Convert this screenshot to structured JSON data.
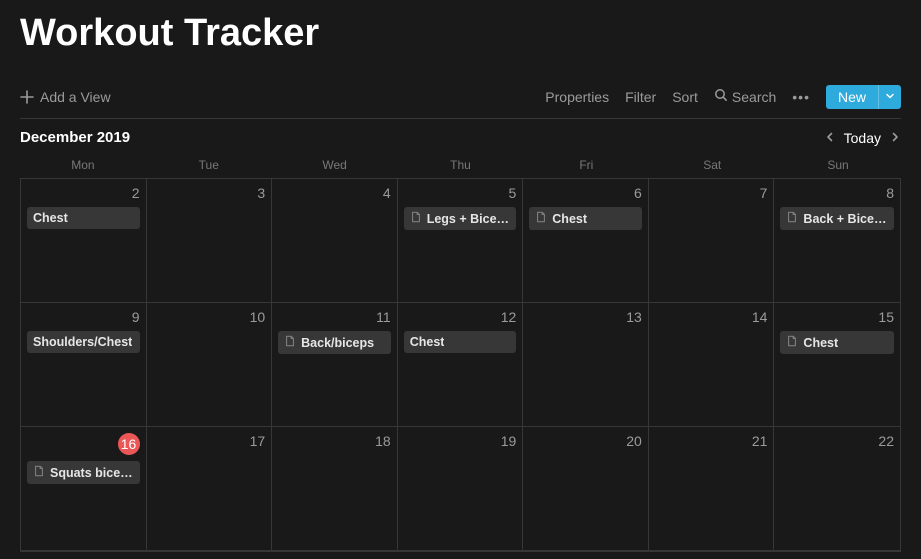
{
  "title": "Workout Tracker",
  "toolbar": {
    "add_view": "Add a View",
    "properties": "Properties",
    "filter": "Filter",
    "sort": "Sort",
    "search": "Search",
    "new": "New"
  },
  "calendar": {
    "month_label": "December 2019",
    "today": "Today",
    "weekdays": [
      "Mon",
      "Tue",
      "Wed",
      "Thu",
      "Fri",
      "Sat",
      "Sun"
    ],
    "weeks": [
      {
        "days": [
          {
            "num": "2",
            "today": false,
            "events": [
              {
                "label": "Chest",
                "icon": false
              }
            ]
          },
          {
            "num": "3",
            "today": false,
            "events": []
          },
          {
            "num": "4",
            "today": false,
            "events": []
          },
          {
            "num": "5",
            "today": false,
            "events": [
              {
                "label": "Legs + Biceps",
                "icon": true
              }
            ]
          },
          {
            "num": "6",
            "today": false,
            "events": [
              {
                "label": "Chest",
                "icon": true
              }
            ]
          },
          {
            "num": "7",
            "today": false,
            "events": []
          },
          {
            "num": "8",
            "today": false,
            "events": [
              {
                "label": "Back + Biceps",
                "icon": true
              }
            ]
          }
        ]
      },
      {
        "days": [
          {
            "num": "9",
            "today": false,
            "events": [
              {
                "label": "Shoulders/Chest",
                "icon": false
              }
            ]
          },
          {
            "num": "10",
            "today": false,
            "events": []
          },
          {
            "num": "11",
            "today": false,
            "events": [
              {
                "label": "Back/biceps",
                "icon": true
              }
            ]
          },
          {
            "num": "12",
            "today": false,
            "events": [
              {
                "label": "Chest",
                "icon": false
              }
            ]
          },
          {
            "num": "13",
            "today": false,
            "events": []
          },
          {
            "num": "14",
            "today": false,
            "events": []
          },
          {
            "num": "15",
            "today": false,
            "events": [
              {
                "label": "Chest",
                "icon": true
              }
            ]
          }
        ]
      },
      {
        "days": [
          {
            "num": "16",
            "today": true,
            "events": [
              {
                "label": "Squats bice…",
                "icon": true
              }
            ]
          },
          {
            "num": "17",
            "today": false,
            "events": []
          },
          {
            "num": "18",
            "today": false,
            "events": []
          },
          {
            "num": "19",
            "today": false,
            "events": []
          },
          {
            "num": "20",
            "today": false,
            "events": []
          },
          {
            "num": "21",
            "today": false,
            "events": []
          },
          {
            "num": "22",
            "today": false,
            "events": []
          }
        ]
      }
    ]
  }
}
